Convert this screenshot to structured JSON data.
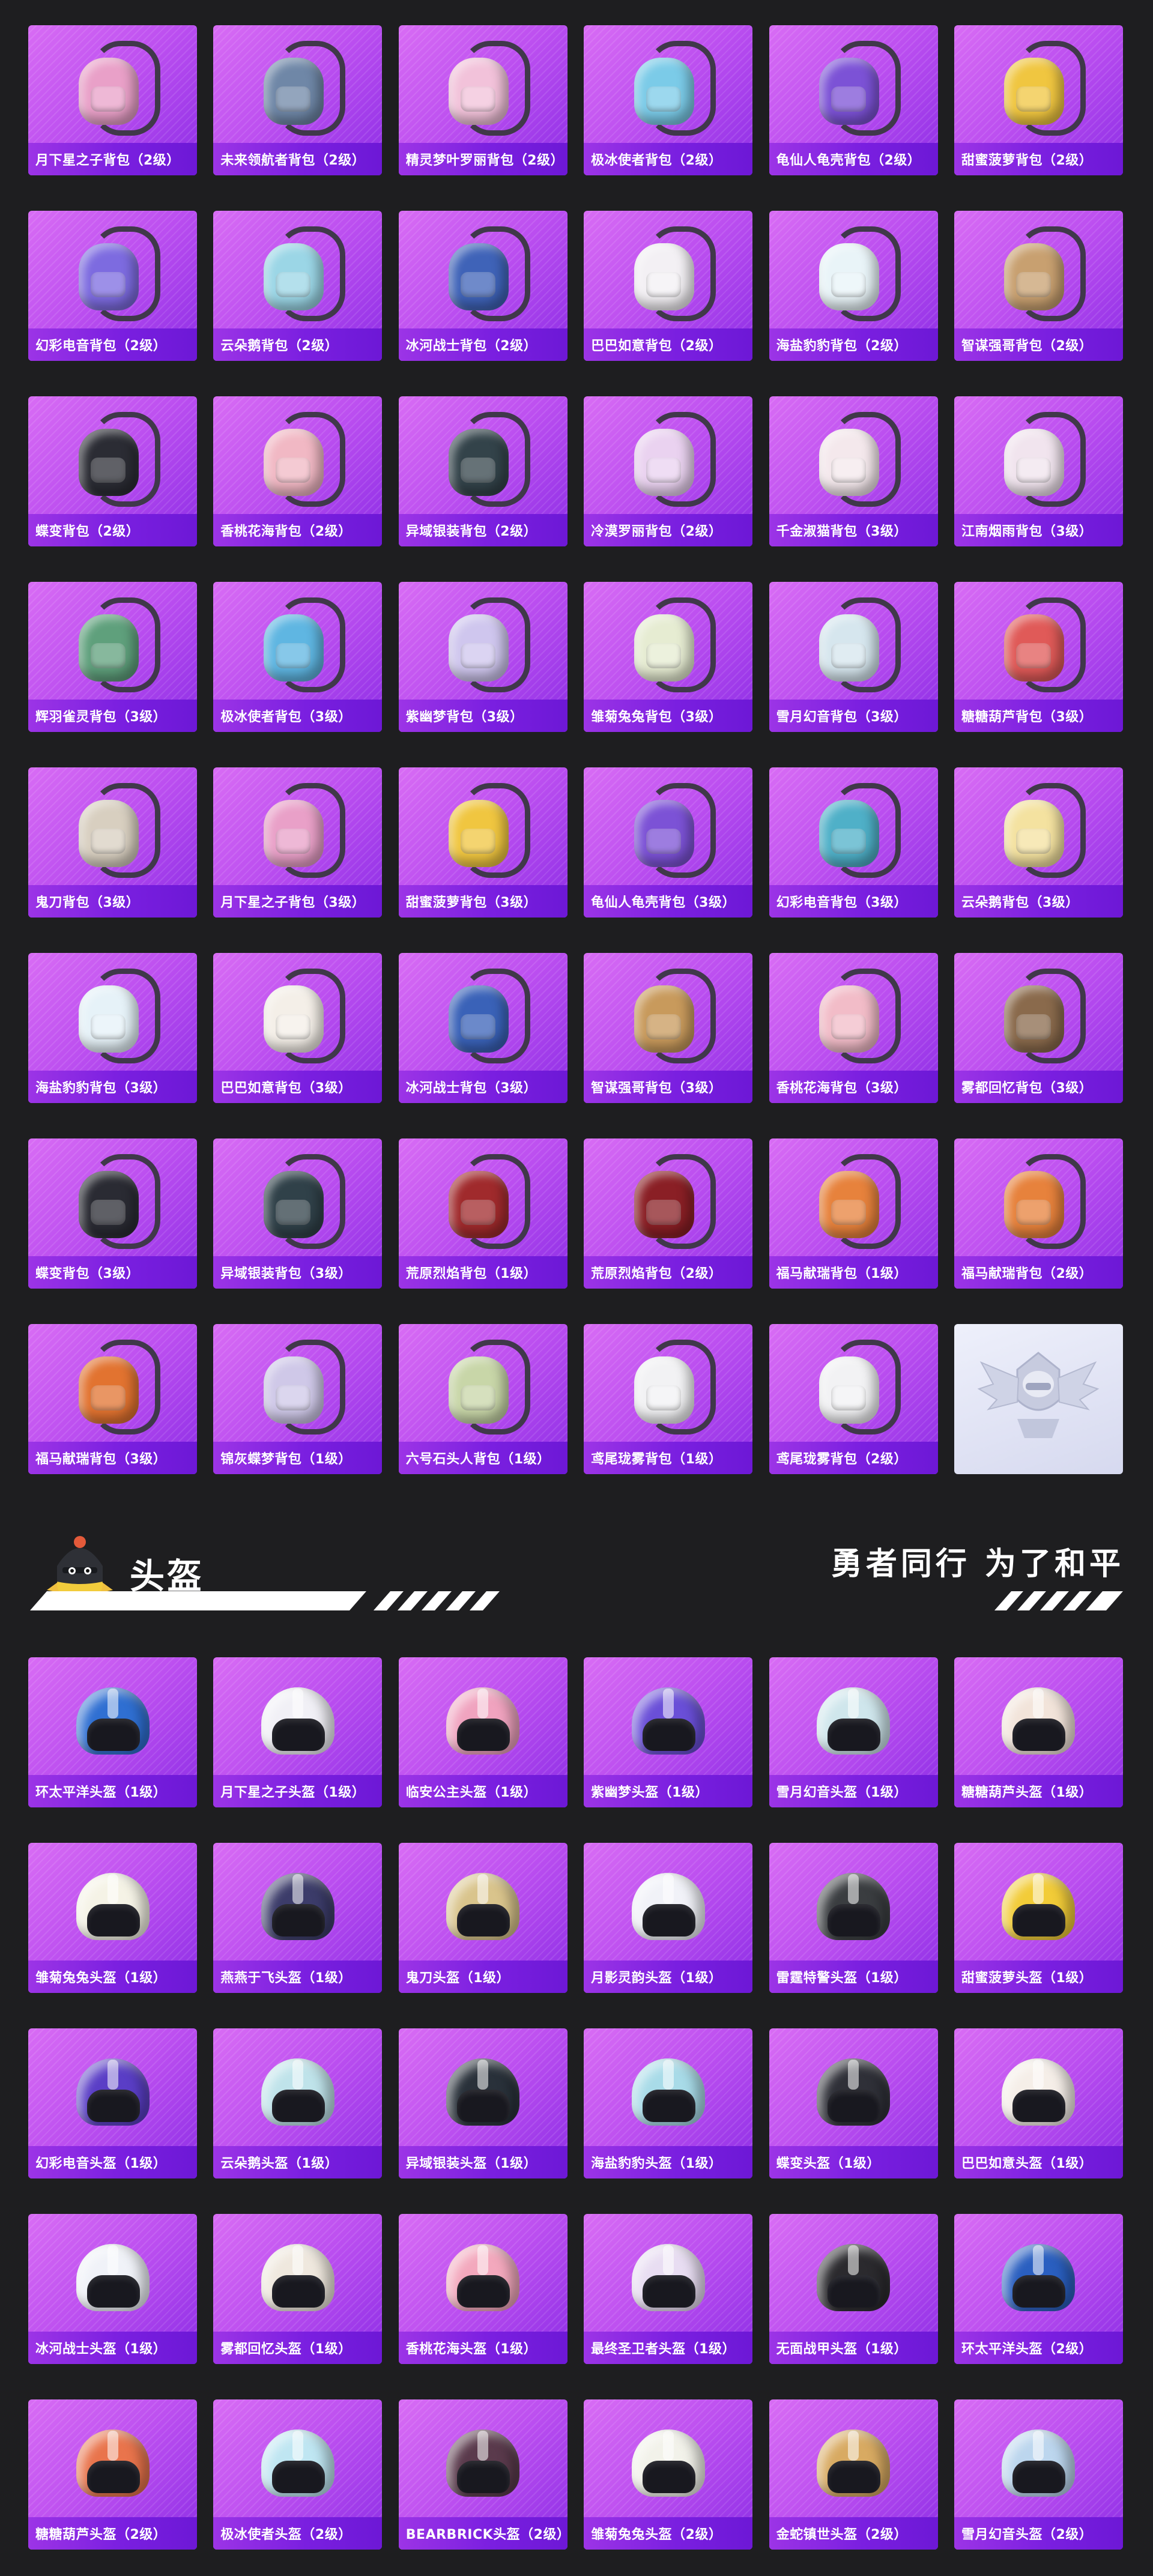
{
  "backpacks": [
    {
      "label": "月下星之子背包（2级）",
      "color": "#e9a0c8",
      "icon": "backpack-icon"
    },
    {
      "label": "未来领航者背包（2级）",
      "color": "#6f87a7",
      "icon": "backpack-icon"
    },
    {
      "label": "精灵梦叶罗丽背包（2级）",
      "color": "#f2c2da",
      "icon": "backpack-icon"
    },
    {
      "label": "极冰使者背包（2级）",
      "color": "#7bcbe8",
      "icon": "backpack-icon"
    },
    {
      "label": "龟仙人龟壳背包（2级）",
      "color": "#7c52d6",
      "icon": "backpack-icon"
    },
    {
      "label": "甜蜜菠萝背包（2级）",
      "color": "#f0c640",
      "icon": "backpack-icon"
    },
    {
      "label": "幻彩电音背包（2级）",
      "color": "#7d6be0",
      "icon": "backpack-icon"
    },
    {
      "label": "云朵鹅背包（2级）",
      "color": "#9bd6e6",
      "icon": "backpack-icon"
    },
    {
      "label": "冰河战士背包（2级）",
      "color": "#3f63b8",
      "icon": "backpack-icon"
    },
    {
      "label": "巴巴如意背包（2级）",
      "color": "#f3f0f4",
      "icon": "backpack-icon"
    },
    {
      "label": "海盐豹豹背包（2级）",
      "color": "#e9f4f8",
      "icon": "backpack-icon"
    },
    {
      "label": "智谋强哥背包（2级）",
      "color": "#c8a070",
      "icon": "backpack-icon"
    },
    {
      "label": "蝶变背包（2级）",
      "color": "#2b2c34",
      "icon": "backpack-icon"
    },
    {
      "label": "香桃花海背包（2级）",
      "color": "#f1b8c4",
      "icon": "backpack-icon"
    },
    {
      "label": "异域银装背包（2级）",
      "color": "#33434a",
      "icon": "backpack-icon"
    },
    {
      "label": "冷漠罗丽背包（2级）",
      "color": "#ead2f0",
      "icon": "backpack-icon"
    },
    {
      "label": "千金淑猫背包（3级）",
      "color": "#f4e8ec",
      "icon": "backpack-icon"
    },
    {
      "label": "江南烟雨背包（3级）",
      "color": "#f1e4ee",
      "icon": "backpack-icon"
    },
    {
      "label": "辉羽雀灵背包（3级）",
      "color": "#5fa07c",
      "icon": "backpack-icon"
    },
    {
      "label": "极冰使者背包（3级）",
      "color": "#5fb6e2",
      "icon": "backpack-icon"
    },
    {
      "label": "紫幽梦背包（3级）",
      "color": "#cfc6ee",
      "icon": "backpack-icon"
    },
    {
      "label": "雏菊兔兔背包（3级）",
      "color": "#e6ecd2",
      "icon": "backpack-icon"
    },
    {
      "label": "雪月幻音背包（3级）",
      "color": "#d6e6ee",
      "icon": "backpack-icon"
    },
    {
      "label": "糖糖葫芦背包（3级）",
      "color": "#e05a58",
      "icon": "backpack-icon"
    },
    {
      "label": "鬼刀背包（3级）",
      "color": "#d8cfc0",
      "icon": "backpack-icon"
    },
    {
      "label": "月下星之子背包（3级）",
      "color": "#e9a0c8",
      "icon": "backpack-icon"
    },
    {
      "label": "甜蜜菠萝背包（3级）",
      "color": "#f0c640",
      "icon": "backpack-icon"
    },
    {
      "label": "龟仙人龟壳背包（3级）",
      "color": "#7c52d6",
      "icon": "backpack-icon"
    },
    {
      "label": "幻彩电音背包（3级）",
      "color": "#4fb0c8",
      "icon": "backpack-icon"
    },
    {
      "label": "云朵鹅背包（3级）",
      "color": "#f4e2a0",
      "icon": "backpack-icon"
    },
    {
      "label": "海盐豹豹背包（3级）",
      "color": "#e6f2f8",
      "icon": "backpack-icon"
    },
    {
      "label": "巴巴如意背包（3级）",
      "color": "#f4efe8",
      "icon": "backpack-icon"
    },
    {
      "label": "冰河战士背包（3级）",
      "color": "#3a62b8",
      "icon": "backpack-icon"
    },
    {
      "label": "智谋强哥背包（3级）",
      "color": "#c89a5c",
      "icon": "backpack-icon"
    },
    {
      "label": "香桃花海背包（3级）",
      "color": "#f2bcc8",
      "icon": "backpack-icon"
    },
    {
      "label": "雾都回忆背包（3级）",
      "color": "#8a6a4c",
      "icon": "backpack-icon"
    },
    {
      "label": "蝶变背包（3级）",
      "color": "#2a2b33",
      "icon": "backpack-icon"
    },
    {
      "label": "异域银装背包（3级）",
      "color": "#304149",
      "icon": "backpack-icon"
    },
    {
      "label": "荒原烈焰背包（1级）",
      "color": "#a02a2c",
      "icon": "backpack-icon"
    },
    {
      "label": "荒原烈焰背包（2级）",
      "color": "#8a1f25",
      "icon": "backpack-icon"
    },
    {
      "label": "福马献瑞背包（1级）",
      "color": "#e7823c",
      "icon": "backpack-icon"
    },
    {
      "label": "福马献瑞背包（2级）",
      "color": "#e7823c",
      "icon": "backpack-icon"
    },
    {
      "label": "福马献瑞背包（3级）",
      "color": "#e27330",
      "icon": "backpack-icon"
    },
    {
      "label": "锦灰蝶梦背包（1级）",
      "color": "#cfc8e8",
      "icon": "backpack-icon"
    },
    {
      "label": "六号石头人背包（1级）",
      "color": "#c8d6a8",
      "icon": "backpack-icon"
    },
    {
      "label": "鸢尾珑雾背包（1级）",
      "color": "#f2f2f4",
      "icon": "backpack-icon"
    },
    {
      "label": "鸢尾珑雾背包（2级）",
      "color": "#f2f2f4",
      "icon": "backpack-icon"
    },
    {
      "label": "",
      "color": "#d8dbea",
      "icon": "winged-helmet-emblem-icon",
      "placeholder": true
    }
  ],
  "section": {
    "title": "头盔",
    "slogan": "勇者同行 为了和平",
    "mascot_icon": "knight-helmet-mascot-icon"
  },
  "helmets": [
    {
      "label": "环太平洋头盔（1级）",
      "color": "#2f6fd2",
      "icon": "helmet-icon"
    },
    {
      "label": "月下星之子头盔（1级）",
      "color": "#f1f0f6",
      "icon": "helmet-icon"
    },
    {
      "label": "临安公主头盔（1级）",
      "color": "#f0a3bf",
      "icon": "helmet-icon"
    },
    {
      "label": "紫幽梦头盔（1级）",
      "color": "#6a4fd8",
      "icon": "helmet-icon"
    },
    {
      "label": "雪月幻音头盔（1级）",
      "color": "#cfe6ec",
      "icon": "helmet-icon"
    },
    {
      "label": "糖糖葫芦头盔（1级）",
      "color": "#f2e4da",
      "icon": "helmet-icon"
    },
    {
      "label": "雏菊兔兔头盔（1级）",
      "color": "#f5f3e6",
      "icon": "helmet-icon"
    },
    {
      "label": "燕燕于飞头盔（1级）",
      "color": "#3c3c6a",
      "icon": "helmet-icon"
    },
    {
      "label": "鬼刀头盔（1级）",
      "color": "#d9c48c",
      "icon": "helmet-icon"
    },
    {
      "label": "月影灵韵头盔（1级）",
      "color": "#f1f2f8",
      "icon": "helmet-icon"
    },
    {
      "label": "雷霆特警头盔（1级）",
      "color": "#3a3d40",
      "icon": "helmet-icon"
    },
    {
      "label": "甜蜜菠萝头盔（1级）",
      "color": "#f2cc38",
      "icon": "helmet-icon"
    },
    {
      "label": "幻彩电音头盔（1级）",
      "color": "#5a3ec6",
      "icon": "helmet-icon"
    },
    {
      "label": "云朵鹅头盔（1级）",
      "color": "#bfe3ea",
      "icon": "helmet-icon"
    },
    {
      "label": "异域银装头盔（1级）",
      "color": "#29313a",
      "icon": "helmet-icon"
    },
    {
      "label": "海盐豹豹头盔（1级）",
      "color": "#a8dbe8",
      "icon": "helmet-icon"
    },
    {
      "label": "蝶变头盔（1级）",
      "color": "#2f3038",
      "icon": "helmet-icon"
    },
    {
      "label": "巴巴如意头盔（1级）",
      "color": "#f5eee8",
      "icon": "helmet-icon"
    },
    {
      "label": "冰河战士头盔（1级）",
      "color": "#f0f2f8",
      "icon": "helmet-icon"
    },
    {
      "label": "雾都回忆头盔（1级）",
      "color": "#efe8de",
      "icon": "helmet-icon"
    },
    {
      "label": "香桃花海头盔（1级）",
      "color": "#f3a8bd",
      "icon": "helmet-icon"
    },
    {
      "label": "最终圣卫者头盔（1级）",
      "color": "#e8ddf2",
      "icon": "helmet-icon"
    },
    {
      "label": "无面战甲头盔（1级）",
      "color": "#2b2a2e",
      "icon": "helmet-icon"
    },
    {
      "label": "环太平洋头盔（2级）",
      "color": "#2a5fc0",
      "icon": "helmet-icon"
    },
    {
      "label": "糖糖葫芦头盔（2级）",
      "color": "#e9744c",
      "icon": "helmet-icon"
    },
    {
      "label": "极冰使者头盔（2级）",
      "color": "#bfe6f2",
      "icon": "helmet-icon"
    },
    {
      "label": "BEARBRICK头盔（2级）",
      "color": "#5a3a4c",
      "icon": "helmet-icon"
    },
    {
      "label": "雏菊兔兔头盔（2级）",
      "color": "#f2f2ea",
      "icon": "helmet-icon"
    },
    {
      "label": "金蛇镇世头盔（2级）",
      "color": "#d8aa62",
      "icon": "helmet-icon"
    },
    {
      "label": "雪月幻音头盔（2级）",
      "color": "#bcd6ee",
      "icon": "helmet-icon"
    }
  ]
}
